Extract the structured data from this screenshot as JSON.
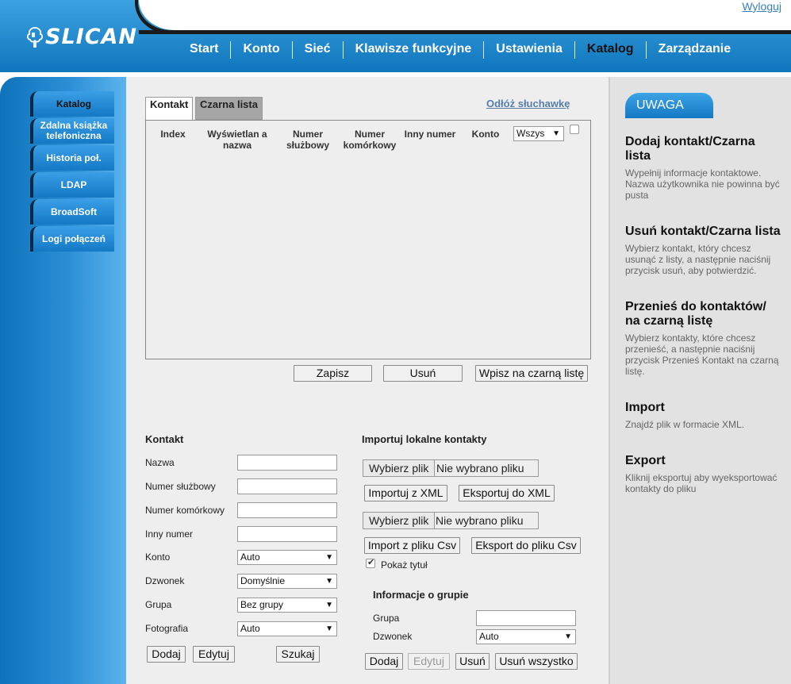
{
  "header": {
    "logo_text": "SLICAN",
    "logout": "Wyloguj",
    "nav": [
      "Start",
      "Konto",
      "Sieć",
      "Klawisze funkcyjne",
      "Ustawienia",
      "Katalog",
      "Zarządzanie"
    ]
  },
  "sidebar": {
    "items": [
      "Katalog",
      "Zdalna książka telefoniczna",
      "Historia poł.",
      "LDAP",
      "BroadSoft",
      "Logi połączeń"
    ]
  },
  "tabs": {
    "contact": "Kontakt",
    "blacklist": "Czarna lista",
    "hangup": "Odłóż słuchawkę"
  },
  "table": {
    "headers": [
      "Index",
      "Wyświetlan a nazwa",
      "Numer służbowy",
      "Numer komórkowy",
      "Inny numer",
      "Konto"
    ],
    "account_filter": "Wszys"
  },
  "table_buttons": {
    "save": "Zapisz",
    "delete": "Usuń",
    "to_blacklist": "Wpisz na czarną listę"
  },
  "contact_form": {
    "title": "Kontakt",
    "name_label": "Nazwa",
    "office_label": "Numer służbowy",
    "mobile_label": "Numer komórkowy",
    "other_label": "Inny numer",
    "account_label": "Konto",
    "account_value": "Auto",
    "ring_label": "Dzwonek",
    "ring_value": "Domyślnie",
    "group_label": "Grupa",
    "group_value": "Bez grupy",
    "photo_label": "Fotografia",
    "photo_value": "Auto",
    "add": "Dodaj",
    "edit": "Edytuj",
    "search": "Szukaj"
  },
  "import_section": {
    "title": "Importuj lokalne kontakty",
    "choose_file": "Wybierz plik",
    "no_file": "Nie wybrano pliku",
    "import_xml": "Importuj z XML",
    "export_xml": "Eksportuj do XML",
    "import_csv": "Import z pliku Csv",
    "export_csv": "Eksport do pliku Csv",
    "show_title": "Pokaż tytuł"
  },
  "group_info": {
    "title": "Informacje o grupie",
    "group_label": "Grupa",
    "ring_label": "Dzwonek",
    "ring_value": "Auto",
    "add": "Dodaj",
    "edit": "Edytuj",
    "delete": "Usuń",
    "delete_all": "Usuń wszystko"
  },
  "help": {
    "badge": "UWAGA",
    "add_title": "Dodaj kontakt/Czarna lista",
    "add_text": "Wypełnij informacje kontaktowe. Nazwa użytkownika nie powinna być pusta",
    "remove_title": "Usuń kontakt/Czarna lista",
    "remove_text": "Wybierz kontakt, który chcesz usunąć z listy, a następnie naciśnij przycisk usuń, aby potwierdzić.",
    "move_title": "Przenieś do kontaktów/ na czarną listę",
    "move_text": "Wybierz kontakty, które chcesz przenieść, a następnie naciśnij przycisk Przenieś Kontakt na czarną listę.",
    "import_title": "Import",
    "import_text": "Znajdź plik w formacie XML.",
    "export_title": "Export",
    "export_text": "Kliknij eksportuj aby wyeksportować kontakty do pliku"
  },
  "colors": {
    "brand_blue": "#1a82cc",
    "active_nav": "#111111",
    "link": "#567ea9"
  }
}
